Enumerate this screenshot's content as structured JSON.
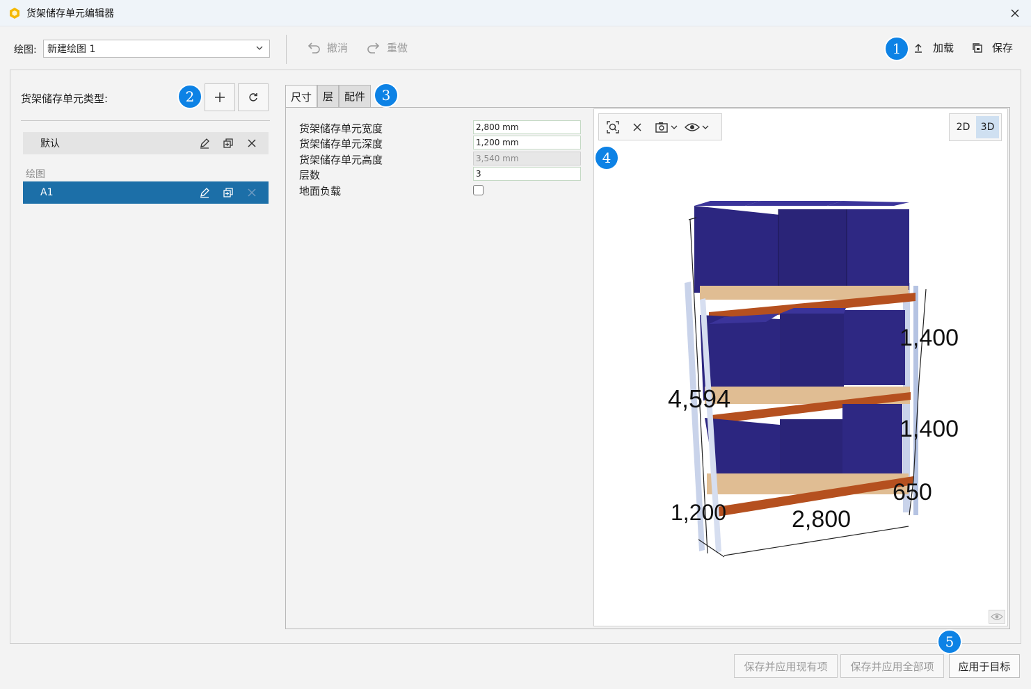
{
  "window": {
    "title": "货架储存单元编辑器"
  },
  "toolbar": {
    "drawing_label": "绘图:",
    "drawing_value": "新建绘图 1",
    "undo": "撤消",
    "redo": "重做",
    "load": "加载",
    "save": "保存"
  },
  "left": {
    "title": "货架储存单元类型:",
    "default_item": "默认",
    "group_label": "绘图",
    "selected_item": "A1"
  },
  "tabs": [
    "尺寸",
    "层",
    "配件"
  ],
  "properties": [
    {
      "label": "货架储存单元宽度",
      "value": "2,800 mm",
      "disabled": false
    },
    {
      "label": "货架储存单元深度",
      "value": "1,200 mm",
      "disabled": false
    },
    {
      "label": "货架储存单元高度",
      "value": "3,540 mm",
      "disabled": true
    },
    {
      "label": "层数",
      "value": "3",
      "disabled": false
    },
    {
      "label": "地面负载",
      "value": "",
      "checked": false
    }
  ],
  "viewport": {
    "mode_2d": "2D",
    "mode_3d": "3D",
    "active_mode": "3D",
    "dimensions": {
      "total_height": "4,594",
      "level_top": "1,400",
      "level_mid": "1,400",
      "level_bottom": "650",
      "depth": "1,200",
      "width": "2,800"
    }
  },
  "badges": [
    "1",
    "2",
    "3",
    "4",
    "5"
  ],
  "footer": {
    "save_apply_existing": "保存并应用现有项",
    "save_apply_all": "保存并应用全部项",
    "apply_target": "应用于目标"
  },
  "colors": {
    "accent": "#0d82e5",
    "selection": "#1c6fa8",
    "box": "#2c2680",
    "beam": "#b5501f",
    "pallet": "#e0bd93",
    "upright": "#c9d3ea"
  }
}
